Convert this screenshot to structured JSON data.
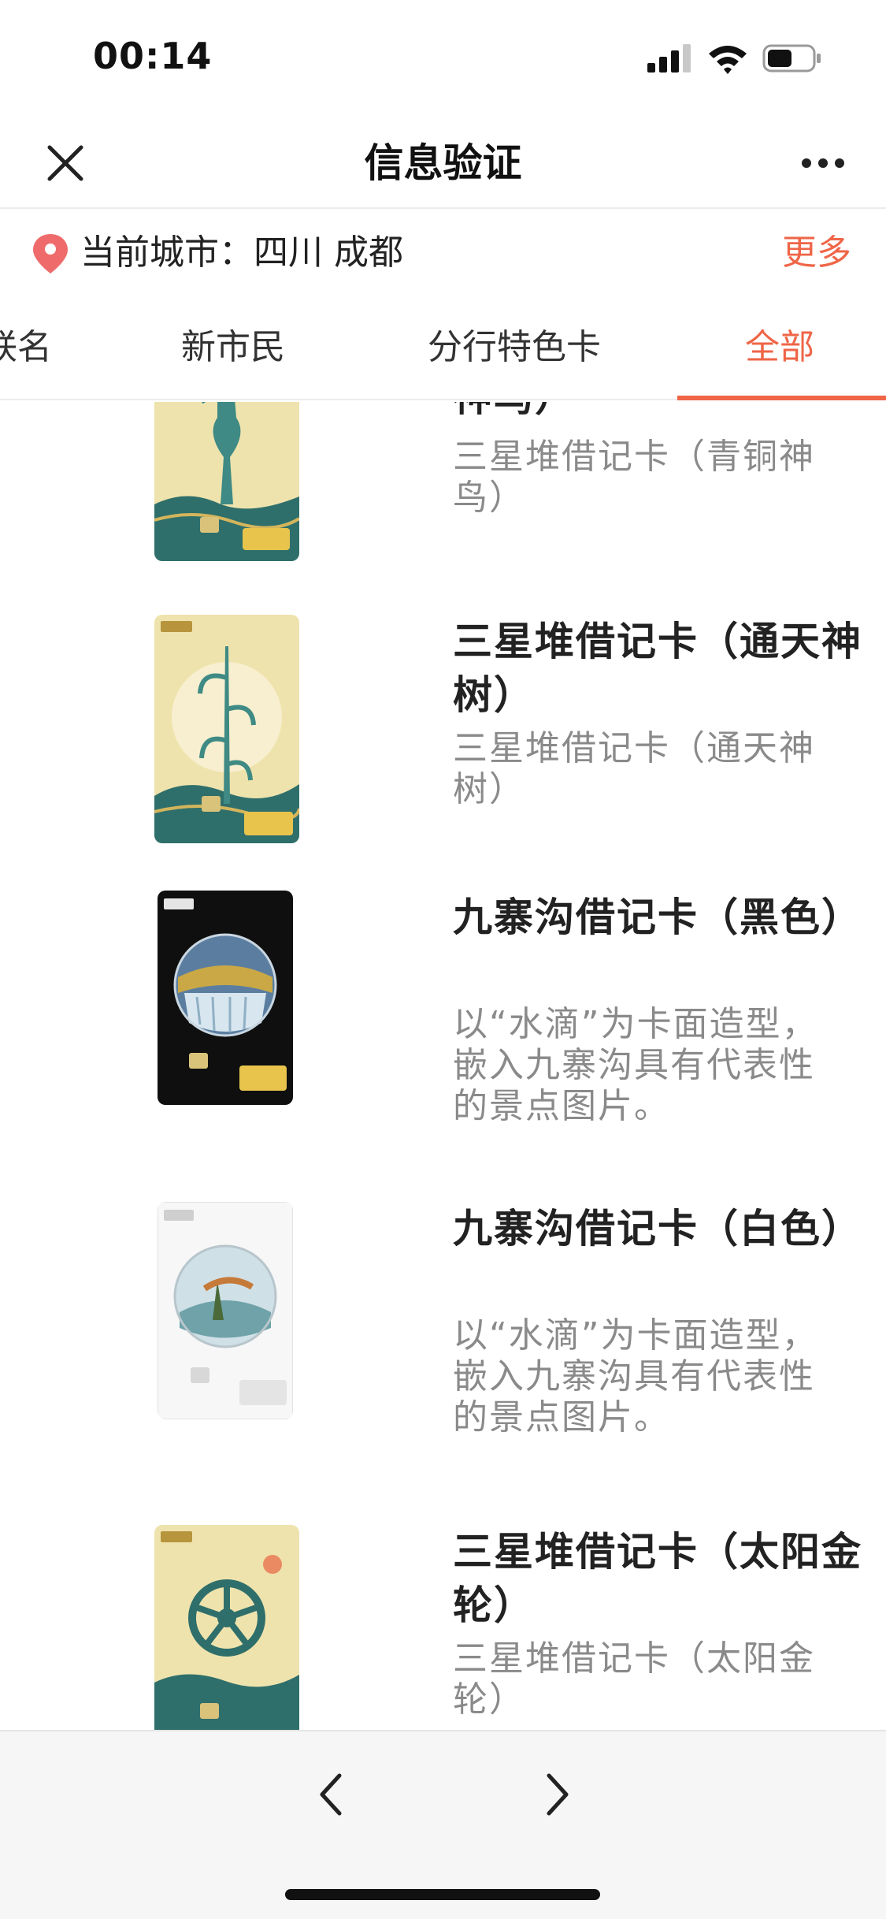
{
  "status": {
    "time": "00:14"
  },
  "nav": {
    "title": "信息验证"
  },
  "city": {
    "label": "当前城市：四川 成都",
    "more": "更多"
  },
  "tabs": [
    {
      "label": "联名"
    },
    {
      "label": "新市民"
    },
    {
      "label": "分行特色卡"
    },
    {
      "label": "全部",
      "active": true
    }
  ],
  "items": [
    {
      "title": "神鸟）",
      "desc": "三星堆借记卡（青铜神鸟）",
      "card": "bronze-bird"
    },
    {
      "title": "三星堆借记卡（通天神树）",
      "desc": "三星堆借记卡（通天神树）",
      "card": "sacred-tree"
    },
    {
      "title": "九寨沟借记卡（黑色）",
      "desc": "以“水滴”为卡面造型，嵌入九寨沟具有代表性的景点图片。",
      "card": "jiuzhai-black"
    },
    {
      "title": "九寨沟借记卡（白色）",
      "desc": "以“水滴”为卡面造型，嵌入九寨沟具有代表性的景点图片。",
      "card": "jiuzhai-white"
    },
    {
      "title": "三星堆借记卡（太阳金轮）",
      "desc": "三星堆借记卡（太阳金轮）",
      "card": "sun-wheel"
    }
  ],
  "colors": {
    "accent": "#ef6547",
    "title": "#222222",
    "desc": "#8a8a8a",
    "card_gold": "#efe0a8",
    "card_teal": "#2f6f6b"
  },
  "icons": {
    "close": "close-icon",
    "more": "more-dots-icon",
    "pin": "location-pin-icon",
    "back": "chevron-left-icon",
    "forward": "chevron-right-icon"
  }
}
